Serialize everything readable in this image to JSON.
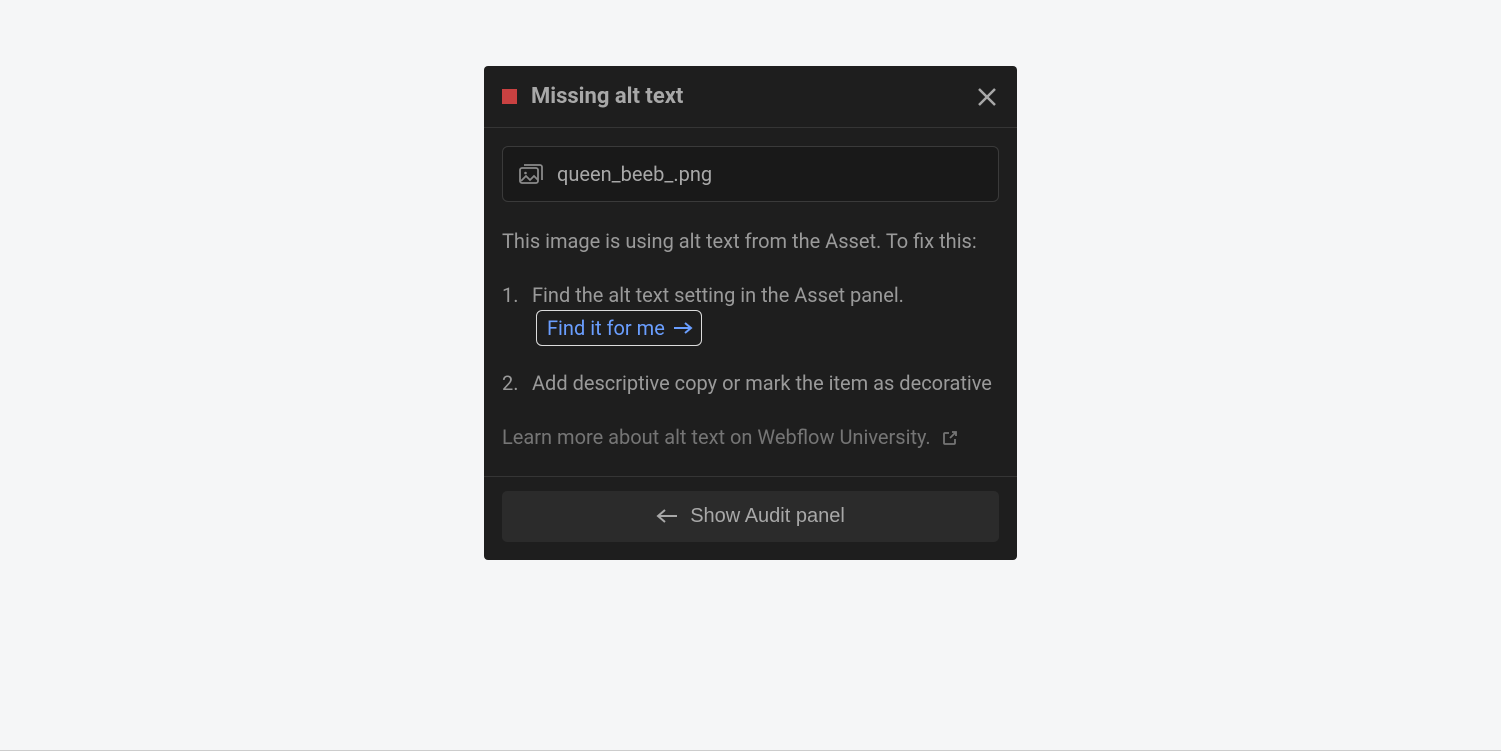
{
  "panel": {
    "title": "Missing alt text",
    "asset_filename": "queen_beeb_.png",
    "description": "This image is using alt text from the Asset. To fix this:",
    "steps": {
      "step1_prefix": "Find the alt text setting in the Asset panel.",
      "find_link": "Find it for me",
      "step2": "Add descriptive copy or mark the item as decorative"
    },
    "learn_more": "Learn more about alt text on Webflow University.",
    "footer_button": "Show Audit panel"
  }
}
